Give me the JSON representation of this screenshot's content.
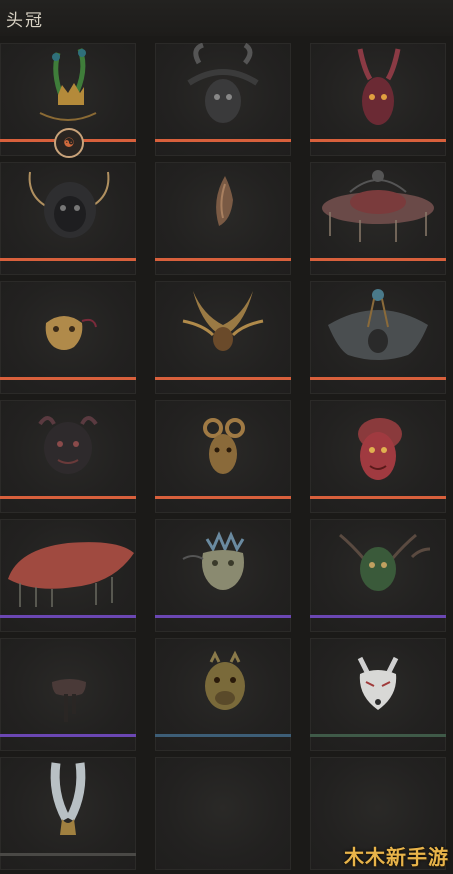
{
  "header": {
    "title": "头冠"
  },
  "items": [
    {
      "id": "item-1",
      "art": "feathered-gold-crown-icon",
      "quality": "orange",
      "equipped": true
    },
    {
      "id": "item-2",
      "art": "horned-black-mask-icon",
      "quality": "orange"
    },
    {
      "id": "item-3",
      "art": "red-horned-mask-icon",
      "quality": "orange"
    },
    {
      "id": "item-4",
      "art": "black-lion-mask-icon",
      "quality": "orange"
    },
    {
      "id": "item-5",
      "art": "bronze-flame-ornament-icon",
      "quality": "orange"
    },
    {
      "id": "item-6",
      "art": "red-brim-hat-icon",
      "quality": "orange"
    },
    {
      "id": "item-7",
      "art": "gold-half-mask-icon",
      "quality": "orange"
    },
    {
      "id": "item-8",
      "art": "gold-winged-mask-icon",
      "quality": "orange"
    },
    {
      "id": "item-9",
      "art": "grey-cloak-hood-icon",
      "quality": "orange"
    },
    {
      "id": "item-10",
      "art": "dark-demon-mask-icon",
      "quality": "orange"
    },
    {
      "id": "item-11",
      "art": "golden-ram-mask-icon",
      "quality": "orange"
    },
    {
      "id": "item-12",
      "art": "red-demon-mask-icon",
      "quality": "orange"
    },
    {
      "id": "item-13",
      "art": "red-wide-hat-icon",
      "quality": "purple"
    },
    {
      "id": "item-14",
      "art": "dragon-head-mask-icon",
      "quality": "purple"
    },
    {
      "id": "item-15",
      "art": "green-antler-mask-icon",
      "quality": "purple"
    },
    {
      "id": "item-16",
      "art": "dark-blindfold-icon",
      "quality": "purple"
    },
    {
      "id": "item-17",
      "art": "boar-mask-icon",
      "quality": "blue"
    },
    {
      "id": "item-18",
      "art": "white-fox-mask-icon",
      "quality": "green"
    },
    {
      "id": "item-19",
      "art": "white-feather-headdress-icon",
      "quality": "gray"
    },
    {
      "id": "item-20",
      "art": "empty-slot",
      "quality": "none"
    },
    {
      "id": "item-21",
      "art": "empty-slot",
      "quality": "none"
    }
  ],
  "equipped_mark": "☯",
  "watermark": "木木新手游",
  "colors": {
    "orange": "#d8603c",
    "purple": "#6b47b3",
    "blue": "#3d5e77",
    "green": "#3f5a48",
    "gray": "#4a4946",
    "background": "#1b1a18"
  }
}
